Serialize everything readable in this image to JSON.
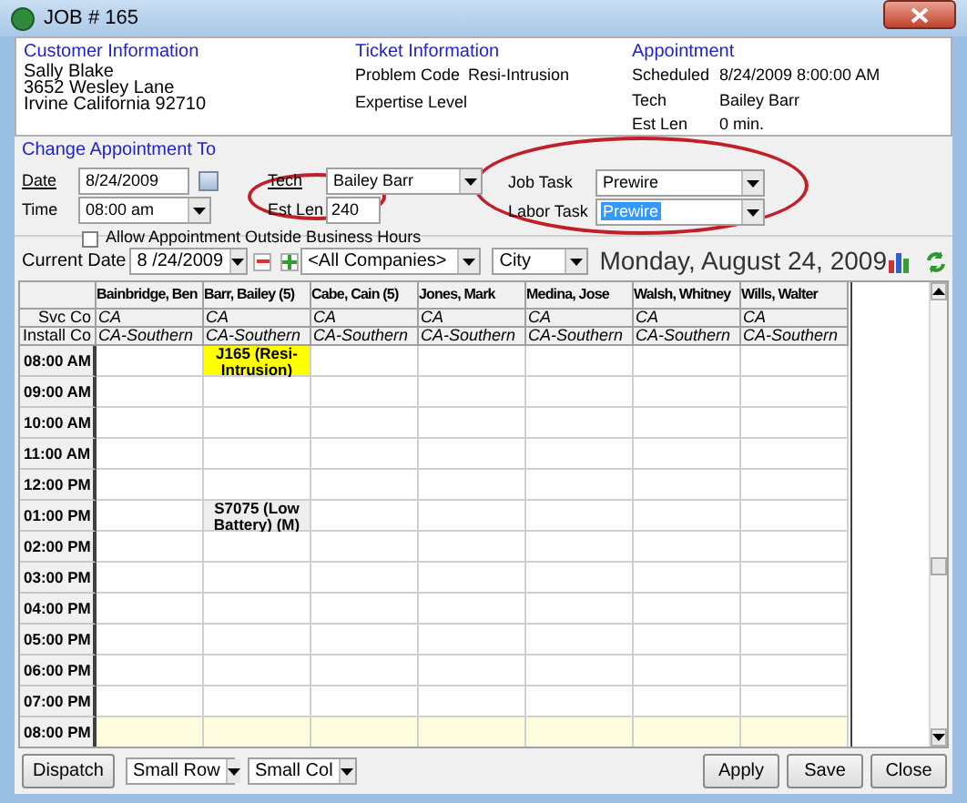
{
  "window": {
    "title": "JOB # 165"
  },
  "customer": {
    "heading": "Customer Information",
    "lines": [
      "Sally Blake",
      "3652 Wesley Lane",
      "Irvine California 92710"
    ]
  },
  "ticket": {
    "heading": "Ticket Information",
    "fields": [
      {
        "label": "Problem Code",
        "value": "Resi-Intrusion"
      },
      {
        "label": "Expertise Level"
      }
    ]
  },
  "appointment": {
    "heading": "Appointment",
    "fields": [
      {
        "label": "Scheduled",
        "value": "8/24/2009 8:00:00 AM"
      },
      {
        "label": "Tech",
        "value": "Bailey Barr"
      },
      {
        "label": "Est Len",
        "value": "0 min."
      }
    ]
  },
  "change": {
    "heading": "Change Appointment To",
    "date": {
      "label": "Date",
      "value": "8/24/2009"
    },
    "time": {
      "label": "Time",
      "value": "08:00 am"
    },
    "allow_outside_hours": {
      "label": "Allow Appointment Outside Business Hours",
      "checked": false
    },
    "tech": {
      "label": "Tech",
      "value": "Bailey Barr"
    },
    "est_len": {
      "label": "Est Len",
      "value": "240"
    },
    "job_task": {
      "label": "Job Task",
      "value": "Prewire"
    },
    "labor_task": {
      "label": "Labor Task",
      "value": "Prewire",
      "selected": true
    }
  },
  "toolbar": {
    "current_date_label": "Current Date",
    "current_date": "8 /24/2009",
    "company": "<All Companies>",
    "sort": "City",
    "date_heading": "Monday, August 24, 2009"
  },
  "schedule": {
    "columns": [
      "Bainbridge, Ben",
      "Barr, Bailey (5)",
      "Cabe, Cain (5)",
      "Jones, Mark",
      "Medina, Jose",
      "Walsh, Whitney",
      "Wills, Walter"
    ],
    "info_rows": [
      {
        "label": "Svc Co",
        "values": [
          "CA",
          "CA",
          "CA",
          "CA",
          "CA",
          "CA",
          "CA"
        ]
      },
      {
        "label": "Install Co",
        "values": [
          "CA-Southern",
          "CA-Southern",
          "CA-Southern",
          "CA-Southern",
          "CA-Southern",
          "CA-Southern",
          "CA-Southern"
        ]
      }
    ],
    "rows": [
      {
        "time": "08:00 AM",
        "after_hours": false,
        "cells": [
          null,
          {
            "text": "J165 (Resi-Intrusion)",
            "color": "#ffff00"
          },
          null,
          null,
          null,
          null,
          null
        ]
      },
      {
        "time": "09:00 AM",
        "after_hours": false,
        "cells": [
          null,
          null,
          null,
          null,
          null,
          null,
          null
        ]
      },
      {
        "time": "10:00 AM",
        "after_hours": false,
        "cells": [
          null,
          null,
          null,
          null,
          null,
          null,
          null
        ]
      },
      {
        "time": "11:00 AM",
        "after_hours": false,
        "cells": [
          null,
          null,
          null,
          null,
          null,
          null,
          null
        ]
      },
      {
        "time": "12:00 PM",
        "after_hours": false,
        "cells": [
          null,
          null,
          null,
          null,
          null,
          null,
          null
        ]
      },
      {
        "time": "01:00 PM",
        "after_hours": false,
        "cells": [
          null,
          {
            "text": "S7075 (Low Battery) (M)",
            "color": "#eeeeee"
          },
          null,
          null,
          null,
          null,
          null
        ]
      },
      {
        "time": "02:00 PM",
        "after_hours": false,
        "cells": [
          null,
          null,
          null,
          null,
          null,
          null,
          null
        ]
      },
      {
        "time": "03:00 PM",
        "after_hours": false,
        "cells": [
          null,
          null,
          null,
          null,
          null,
          null,
          null
        ]
      },
      {
        "time": "04:00 PM",
        "after_hours": false,
        "cells": [
          null,
          null,
          null,
          null,
          null,
          null,
          null
        ]
      },
      {
        "time": "05:00 PM",
        "after_hours": false,
        "cells": [
          null,
          null,
          null,
          null,
          null,
          null,
          null
        ]
      },
      {
        "time": "06:00 PM",
        "after_hours": false,
        "cells": [
          null,
          null,
          null,
          null,
          null,
          null,
          null
        ]
      },
      {
        "time": "07:00 PM",
        "after_hours": false,
        "cells": [
          null,
          null,
          null,
          null,
          null,
          null,
          null
        ]
      },
      {
        "time": "08:00 PM",
        "after_hours": true,
        "cells": [
          null,
          null,
          null,
          null,
          null,
          null,
          null
        ]
      }
    ]
  },
  "footer": {
    "dispatch": "Dispatch",
    "row_size": "Small Row",
    "col_size": "Small Col",
    "buttons": [
      "Apply",
      "Save",
      "Close"
    ]
  }
}
